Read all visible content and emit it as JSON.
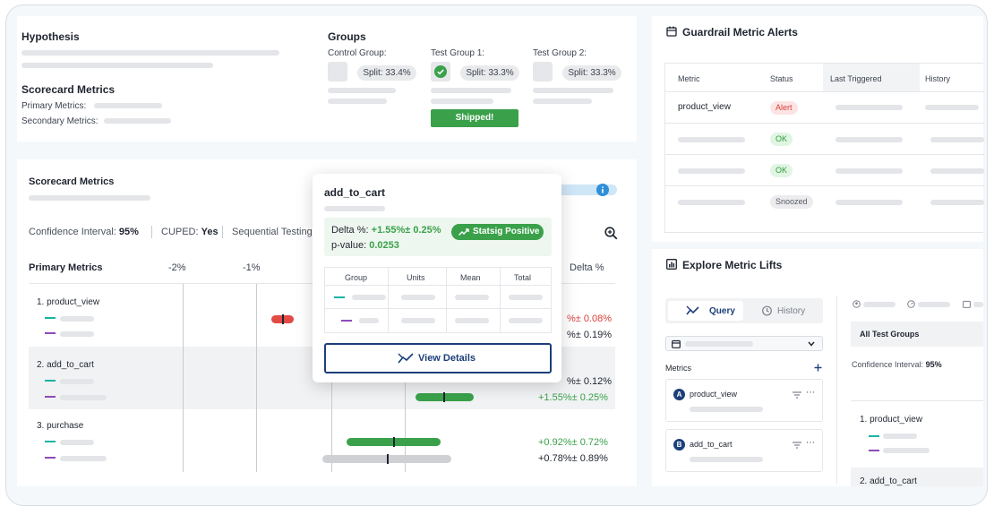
{
  "hypothesis": {
    "title": "Hypothesis"
  },
  "scorecard_top": {
    "title": "Scorecard Metrics",
    "primary_label": "Primary Metrics:",
    "secondary_label": "Secondary Metrics:"
  },
  "groups": {
    "title": "Groups",
    "control": {
      "label": "Control Group:",
      "split": "Split: 33.4%"
    },
    "test1": {
      "label": "Test Group 1:",
      "split": "Split: 33.3%"
    },
    "test2": {
      "label": "Test Group 2:",
      "split": "Split: 33.3%"
    },
    "shipped": "Shipped!"
  },
  "guardrail": {
    "title": "Guardrail Metric Alerts",
    "headers": [
      "Metric",
      "Status",
      "Last Triggered",
      "History"
    ],
    "rows": [
      {
        "metric": "product_view",
        "status": "Alert"
      },
      {
        "metric": "",
        "status": "OK"
      },
      {
        "metric": "",
        "status": "OK"
      },
      {
        "metric": "",
        "status": "Snoozed"
      }
    ]
  },
  "scorecard": {
    "title": "Scorecard Metrics",
    "confidence_label": "Confidence Interval:",
    "confidence_value": "95%",
    "cuped_label": "CUPED:",
    "cuped_value": "Yes",
    "sequential_label": "Sequential Testing",
    "primary_metrics": "Primary Metrics",
    "axis_ticks": [
      "-2%",
      "-1%"
    ],
    "delta_header": "Delta %",
    "metrics": [
      {
        "name": "1. product_view",
        "values": [
          "%± 0.08%",
          "%± 0.19%"
        ]
      },
      {
        "name": "2. add_to_cart",
        "values": [
          "%± 0.12%",
          "+1.55%± 0.25%"
        ]
      },
      {
        "name": "3. purchase",
        "values": [
          "+0.92%± 0.72%",
          "+0.78%± 0.89%"
        ]
      }
    ]
  },
  "popup": {
    "title": "add_to_cart",
    "delta_label": "Delta %:",
    "delta_value": "+1.55%± 0.25%",
    "pvalue_label": "p-value:",
    "pvalue_value": "0.0253",
    "badge": "Statsig Positive",
    "table_headers": [
      "Group",
      "Units",
      "Mean",
      "Total"
    ],
    "button": "View Details"
  },
  "explore": {
    "title": "Explore Metric Lifts",
    "tab_query": "Query",
    "tab_history": "History",
    "metrics_label": "Metrics",
    "metric_a": {
      "letter": "A",
      "name": "product_view"
    },
    "metric_b": {
      "letter": "B",
      "name": "add_to_cart"
    },
    "all_groups": "All Test Groups",
    "confidence_label": "Confidence Interval:",
    "confidence_value": "95%",
    "list": [
      "1. product_view",
      "2. add_to_cart"
    ]
  },
  "colors": {
    "green": "#3aa14a",
    "red": "#d9403a",
    "teal": "#17b3a3",
    "purple": "#8e4bb8",
    "navy": "#1c3f7a"
  }
}
